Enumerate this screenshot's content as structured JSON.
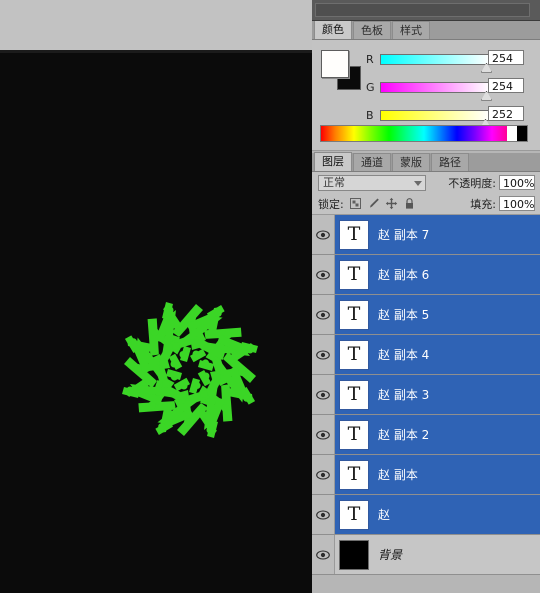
{
  "document": {
    "canvas_background": "#0b0b0b",
    "artwork": {
      "name": "radial-text-mandala",
      "glyph": "赵",
      "color": "#33cc22",
      "copies": 8
    }
  },
  "color_panel": {
    "tabs": [
      {
        "label": "颜色",
        "active": true
      },
      {
        "label": "色板",
        "active": false
      },
      {
        "label": "样式",
        "active": false
      }
    ],
    "foreground_color": "#fffefc",
    "background_color": "#0a0a0a",
    "channels": [
      {
        "label": "R",
        "value": "254",
        "pct": 99.6
      },
      {
        "label": "G",
        "value": "254",
        "pct": 99.6
      },
      {
        "label": "B",
        "value": "252",
        "pct": 98.8
      }
    ]
  },
  "layers_panel": {
    "tabs": [
      {
        "label": "图层",
        "active": true
      },
      {
        "label": "通道",
        "active": false
      },
      {
        "label": "蒙版",
        "active": false
      },
      {
        "label": "路径",
        "active": false
      }
    ],
    "blend_mode": "正常",
    "opacity_label": "不透明度:",
    "opacity_value": "100%",
    "lock_label": "锁定:",
    "fill_label": "填充:",
    "fill_value": "100%",
    "lock_icons": [
      "transparency-lock-icon",
      "paint-lock-icon",
      "move-lock-icon",
      "all-lock-icon"
    ],
    "layers": [
      {
        "name": "赵 副本 7",
        "type": "text",
        "selected": true,
        "visible": true
      },
      {
        "name": "赵 副本 6",
        "type": "text",
        "selected": true,
        "visible": true
      },
      {
        "name": "赵 副本 5",
        "type": "text",
        "selected": true,
        "visible": true
      },
      {
        "name": "赵 副本 4",
        "type": "text",
        "selected": true,
        "visible": true
      },
      {
        "name": "赵 副本 3",
        "type": "text",
        "selected": true,
        "visible": true
      },
      {
        "name": "赵 副本 2",
        "type": "text",
        "selected": true,
        "visible": true
      },
      {
        "name": "赵 副本",
        "type": "text",
        "selected": true,
        "visible": true
      },
      {
        "name": "赵",
        "type": "text",
        "selected": true,
        "visible": true
      },
      {
        "name": "背景",
        "type": "background",
        "selected": false,
        "visible": true
      }
    ],
    "thumb_glyph": "T"
  },
  "colors": {
    "selection_blue": "#2f63b5",
    "panel_gray": "#c3c3c3",
    "tab_active": "#c9c9c9",
    "artwork_green": "#33cc22"
  }
}
